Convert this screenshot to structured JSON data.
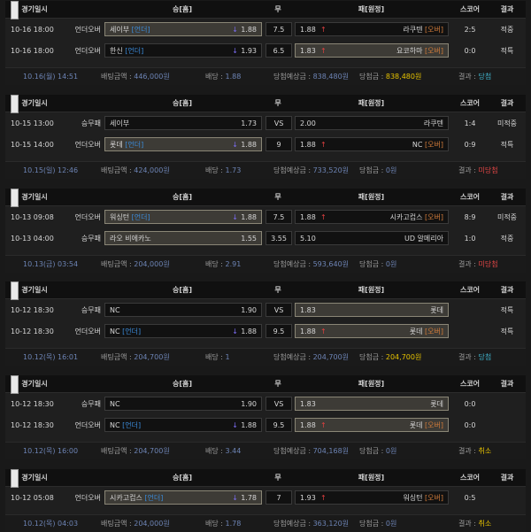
{
  "headers": {
    "time": "경기일시",
    "type": "",
    "home": "승[홈]",
    "draw": "무",
    "away": "패[원정]",
    "score": "스코어",
    "result": "결과"
  },
  "labels": {
    "bet_amount": "배팅금액 : ",
    "odds": "배당 : ",
    "expected": "당첨예상금 : ",
    "winnings": "당첨금 : ",
    "status": "결과 : "
  },
  "colors": {
    "selected_bg": "#3d3b36",
    "under_tag": "#3b8ad8",
    "over_tag": "#d07b3a",
    "hit": "#3fb0c8",
    "miss": "#e04545",
    "win_amount": "#e5c100"
  },
  "slips": [
    {
      "rows": [
        {
          "time": "10-16 18:00",
          "type": "언더오버",
          "home": "세이부",
          "home_tag": "[언더]",
          "home_odds": "1.88",
          "home_arrow": "↓",
          "home_sel": true,
          "draw": "7.5",
          "away": "라쿠텐",
          "away_tag": "[오버]",
          "away_odds": "1.88",
          "away_arrow": "↑",
          "away_sel": false,
          "score": "2:5",
          "result": "적중",
          "result_kind": "hit"
        },
        {
          "time": "10-16 18:00",
          "type": "언더오버",
          "home": "한신",
          "home_tag": "[언더]",
          "home_odds": "1.93",
          "home_arrow": "↓",
          "home_sel": false,
          "draw": "6.5",
          "away": "요코하마",
          "away_tag": "[오버]",
          "away_odds": "1.83",
          "away_arrow": "↑",
          "away_sel": true,
          "score": "0:0",
          "result": "적특",
          "result_kind": "special"
        }
      ],
      "footer": {
        "date": "10.16(월) 14:51",
        "bet_amount": "446,000원",
        "odds": "1.88",
        "expected": "838,480원",
        "winnings": "838,480원",
        "status": "당첨",
        "status_kind": "win"
      }
    },
    {
      "rows": [
        {
          "time": "10-15 13:00",
          "type": "승무패",
          "home": "세이부",
          "home_tag": "",
          "home_odds": "1.73",
          "home_arrow": "",
          "home_sel": false,
          "draw": "VS",
          "draw_box": true,
          "away": "라쿠텐",
          "away_tag": "",
          "away_odds": "2.00",
          "away_arrow": "",
          "away_sel": false,
          "score": "1:4",
          "result": "미적중",
          "result_kind": "miss"
        },
        {
          "time": "10-15 14:00",
          "type": "언더오버",
          "home": "롯데",
          "home_tag": "[언더]",
          "home_odds": "1.88",
          "home_arrow": "↓",
          "home_sel": true,
          "draw": "9",
          "away": "NC",
          "away_tag": "[오버]",
          "away_odds": "1.88",
          "away_arrow": "↑",
          "away_sel": false,
          "score": "0:9",
          "result": "적특",
          "result_kind": "special"
        }
      ],
      "footer": {
        "date": "10.15(일) 12:46",
        "bet_amount": "424,000원",
        "odds": "1.73",
        "expected": "733,520원",
        "winnings": "0원",
        "status": "미당첨",
        "status_kind": "lose"
      }
    },
    {
      "rows": [
        {
          "time": "10-13 09:08",
          "type": "언더오버",
          "home": "워싱턴",
          "home_tag": "[언더]",
          "home_odds": "1.88",
          "home_arrow": "↓",
          "home_sel": true,
          "draw": "7.5",
          "away": "시카고컵스",
          "away_tag": "[오버]",
          "away_odds": "1.88",
          "away_arrow": "↑",
          "away_sel": false,
          "score": "8:9",
          "result": "미적중",
          "result_kind": "miss"
        },
        {
          "time": "10-13 04:00",
          "type": "승무패",
          "home": "라오 비에카노",
          "home_tag": "",
          "home_odds": "1.55",
          "home_arrow": "",
          "home_sel": true,
          "draw": "3.55",
          "away": "UD 알메리아",
          "away_tag": "",
          "away_odds": "5.10",
          "away_arrow": "",
          "away_sel": false,
          "score": "1:0",
          "result": "적중",
          "result_kind": "hit"
        }
      ],
      "footer": {
        "date": "10.13(금) 03:54",
        "bet_amount": "204,000원",
        "odds": "2.91",
        "expected": "593,640원",
        "winnings": "0원",
        "status": "미당첨",
        "status_kind": "lose"
      }
    },
    {
      "rows": [
        {
          "time": "10-12 18:30",
          "type": "승무패",
          "home": "NC",
          "home_tag": "",
          "home_odds": "1.90",
          "home_arrow": "",
          "home_sel": false,
          "draw": "VS",
          "draw_box": true,
          "away": "롯데",
          "away_tag": "",
          "away_odds": "1.83",
          "away_arrow": "",
          "away_sel": true,
          "score": "",
          "result": "적특",
          "result_kind": "special"
        },
        {
          "time": "10-12 18:30",
          "type": "언더오버",
          "home": "NC",
          "home_tag": "[언더]",
          "home_odds": "1.88",
          "home_arrow": "↓",
          "home_sel": false,
          "draw": "9.5",
          "away": "롯데",
          "away_tag": "[오버]",
          "away_odds": "1.88",
          "away_arrow": "↑",
          "away_sel": true,
          "score": "",
          "result": "적특",
          "result_kind": "special"
        }
      ],
      "footer": {
        "date": "10.12(목) 16:01",
        "bet_amount": "204,700원",
        "odds": "1",
        "expected": "204,700원",
        "winnings": "204,700원",
        "status": "당첨",
        "status_kind": "win"
      }
    },
    {
      "rows": [
        {
          "time": "10-12 18:30",
          "type": "승무패",
          "home": "NC",
          "home_tag": "",
          "home_odds": "1.90",
          "home_arrow": "",
          "home_sel": false,
          "draw": "VS",
          "draw_box": true,
          "away": "롯데",
          "away_tag": "",
          "away_odds": "1.83",
          "away_arrow": "",
          "away_sel": true,
          "score": "0:0",
          "result": "",
          "result_kind": "special"
        },
        {
          "time": "10-12 18:30",
          "type": "언더오버",
          "home": "NC",
          "home_tag": "[언더]",
          "home_odds": "1.88",
          "home_arrow": "↓",
          "home_sel": false,
          "draw": "9.5",
          "away": "롯데",
          "away_tag": "[오버]",
          "away_odds": "1.88",
          "away_arrow": "↑",
          "away_sel": true,
          "score": "0:0",
          "result": "",
          "result_kind": "special"
        }
      ],
      "footer": {
        "date": "10.12(목) 16:00",
        "bet_amount": "204,700원",
        "odds": "3.44",
        "expected": "704,168원",
        "winnings": "0원",
        "status": "취소",
        "status_kind": "cancel"
      }
    },
    {
      "rows": [
        {
          "time": "10-12 05:08",
          "type": "언더오버",
          "home": "시카고컵스",
          "home_tag": "[언더]",
          "home_odds": "1.78",
          "home_arrow": "↓",
          "home_sel": true,
          "draw": "7",
          "away": "워싱턴",
          "away_tag": "[오버]",
          "away_odds": "1.93",
          "away_arrow": "↑",
          "away_sel": false,
          "score": "0:5",
          "result": "",
          "result_kind": "special"
        }
      ],
      "footer": {
        "date": "10.12(목) 04:03",
        "bet_amount": "204,000원",
        "odds": "1.78",
        "expected": "363,120원",
        "winnings": "0원",
        "status": "취소",
        "status_kind": "cancel"
      }
    }
  ]
}
